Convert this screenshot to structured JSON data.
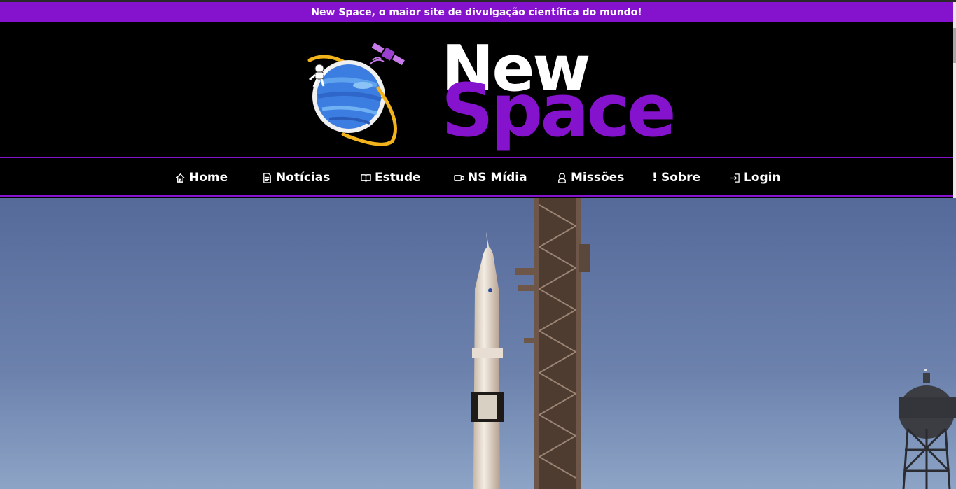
{
  "banner": {
    "text": "New Space, o maior site de divulgação científica do mundo!"
  },
  "logo": {
    "word_top": "New",
    "word_bottom": "Space"
  },
  "nav": {
    "items": [
      {
        "label": "Home",
        "icon": "home-icon"
      },
      {
        "label": "Notícias",
        "icon": "document-icon"
      },
      {
        "label": "Estude",
        "icon": "book-icon"
      },
      {
        "label": "NS Mídia",
        "icon": "video-icon"
      },
      {
        "label": "Missões",
        "icon": "astronaut-icon"
      },
      {
        "label": "Sobre",
        "icon": "exclamation-icon"
      },
      {
        "label": "Login",
        "icon": "login-icon"
      }
    ]
  },
  "hero": {
    "image": "rocket-launch-pad-photo"
  },
  "colors": {
    "accent": "#8512cc",
    "background": "#000000",
    "text": "#ffffff"
  }
}
